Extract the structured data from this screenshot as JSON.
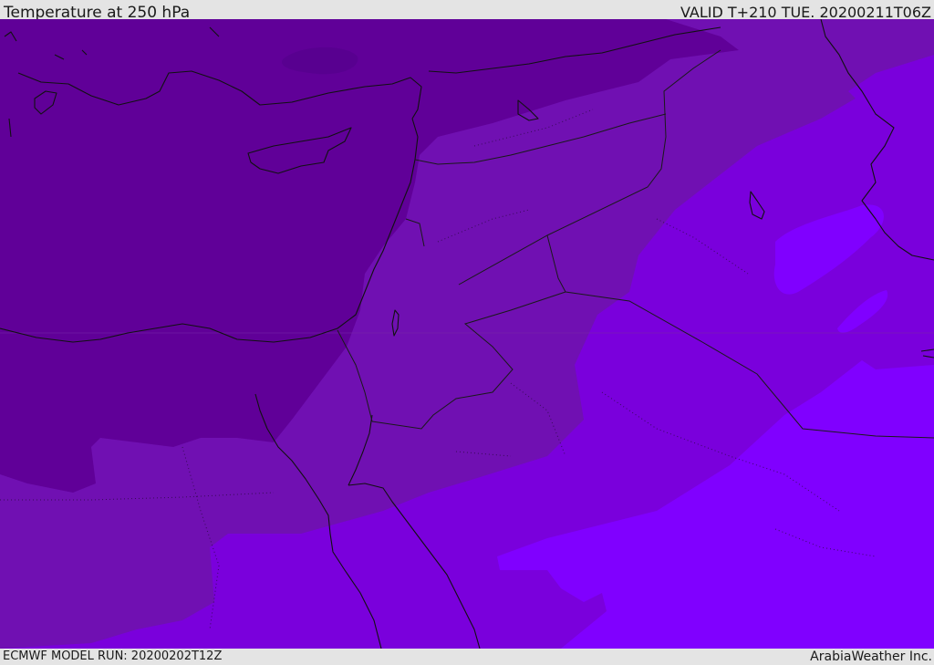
{
  "header": {
    "title": "Temperature at 250 hPa",
    "valid_time": "VALID T+210 TUE. 20200211T06Z"
  },
  "footer": {
    "model_run": "ECMWF MODEL RUN: 20200202T12Z",
    "credit": "ArabiaWeather Inc."
  },
  "colors": {
    "band_coldest": "#600098",
    "band_cold": "#7010b2",
    "band_mid": "#7a00dc",
    "band_warm": "#8000ff",
    "coastline": "#111111",
    "bar": "#e4e4e4"
  }
}
